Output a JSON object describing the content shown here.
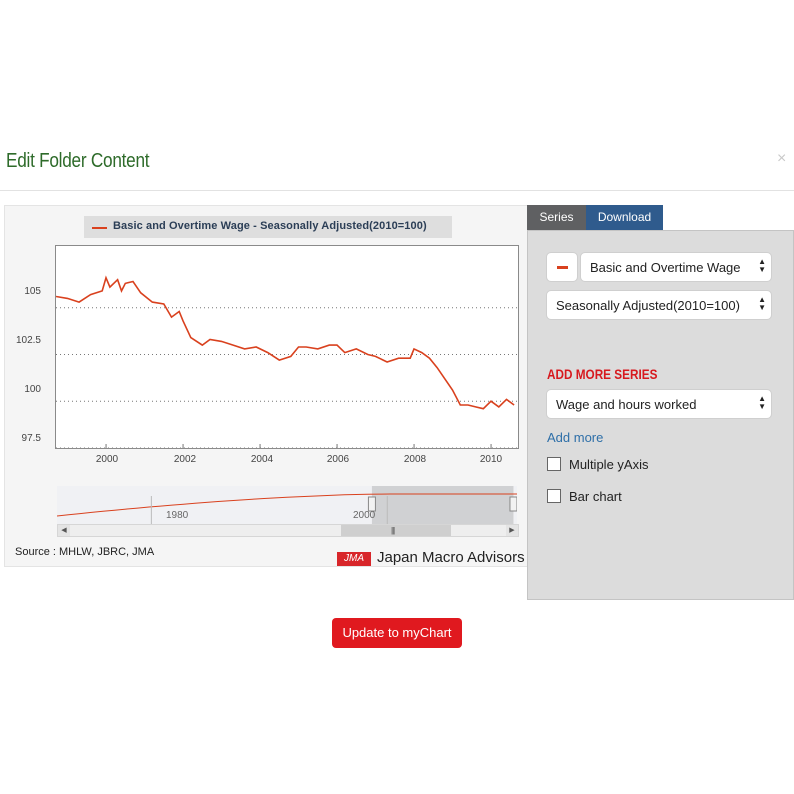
{
  "modal": {
    "title": "Edit Folder Content",
    "close": "×"
  },
  "chart_data": {
    "type": "line",
    "legend": "Basic and Overtime Wage - Seasonally Adjusted(2010=100)",
    "series": [
      {
        "name": "Basic and Overtime Wage - Seasonally Adjusted(2010=100)",
        "color": "#d9411e",
        "x": [
          1998.7,
          1999.0,
          1999.3,
          1999.6,
          1999.9,
          2000.0,
          2000.1,
          2000.3,
          2000.4,
          2000.5,
          2000.7,
          2000.9,
          2001.2,
          2001.5,
          2001.7,
          2001.9,
          2002.0,
          2002.2,
          2002.5,
          2002.7,
          2003.0,
          2003.3,
          2003.6,
          2003.9,
          2004.2,
          2004.5,
          2004.8,
          2005.0,
          2005.2,
          2005.5,
          2005.8,
          2006.0,
          2006.2,
          2006.5,
          2006.8,
          2007.0,
          2007.3,
          2007.6,
          2007.9,
          2008.0,
          2008.2,
          2008.4,
          2008.6,
          2008.8,
          2009.0,
          2009.2,
          2009.4,
          2009.6,
          2009.8,
          2010.0,
          2010.2,
          2010.4,
          2010.6
        ],
        "y": [
          105.6,
          105.5,
          105.3,
          105.7,
          105.9,
          106.6,
          106.1,
          106.5,
          105.9,
          106.3,
          106.4,
          105.8,
          105.3,
          105.2,
          104.5,
          104.8,
          104.3,
          103.4,
          103.0,
          103.3,
          103.2,
          103.0,
          102.8,
          102.9,
          102.6,
          102.2,
          102.4,
          102.9,
          102.9,
          102.8,
          103.0,
          103.0,
          102.6,
          102.8,
          102.5,
          102.4,
          102.1,
          102.3,
          102.3,
          102.8,
          102.6,
          102.3,
          101.8,
          101.2,
          100.6,
          99.8,
          99.8,
          99.7,
          99.6,
          100.0,
          99.7,
          100.1,
          99.8
        ]
      }
    ],
    "yticks": [
      "105",
      "102.5",
      "100",
      "97.5"
    ],
    "xticks": [
      "2000",
      "2002",
      "2004",
      "2006",
      "2008",
      "2010"
    ],
    "ylim": [
      97.5,
      108.3
    ],
    "xlim": [
      1998.7,
      2010.7
    ],
    "grid": "horizontal dotted",
    "navigator_labels": [
      "1980",
      "2000"
    ],
    "navigator_range": [
      1972,
      2011
    ],
    "navigator_selected": [
      1998.7,
      2010.7
    ]
  },
  "source": "Source : MHLW, JBRC, JMA",
  "logo": {
    "badge": "JMA",
    "text": "Japan Macro Advisors"
  },
  "tabs": {
    "series": "Series",
    "download": "Download"
  },
  "series_panel": {
    "series_select": "Basic and Overtime Wage",
    "adjustment_select": "Seasonally Adjusted(2010=100)",
    "add_more_series_heading": "ADD MORE SERIES",
    "add_series_select": "Wage and hours worked",
    "add_more_link": "Add more",
    "multiple_yaxis_label": "Multiple yAxis",
    "bar_chart_label": "Bar chart"
  },
  "update_button": "Update to myChart",
  "icons": {
    "close": "close-icon",
    "select_arrows": "up-down-arrows-icon",
    "remove_series": "minus-icon"
  }
}
